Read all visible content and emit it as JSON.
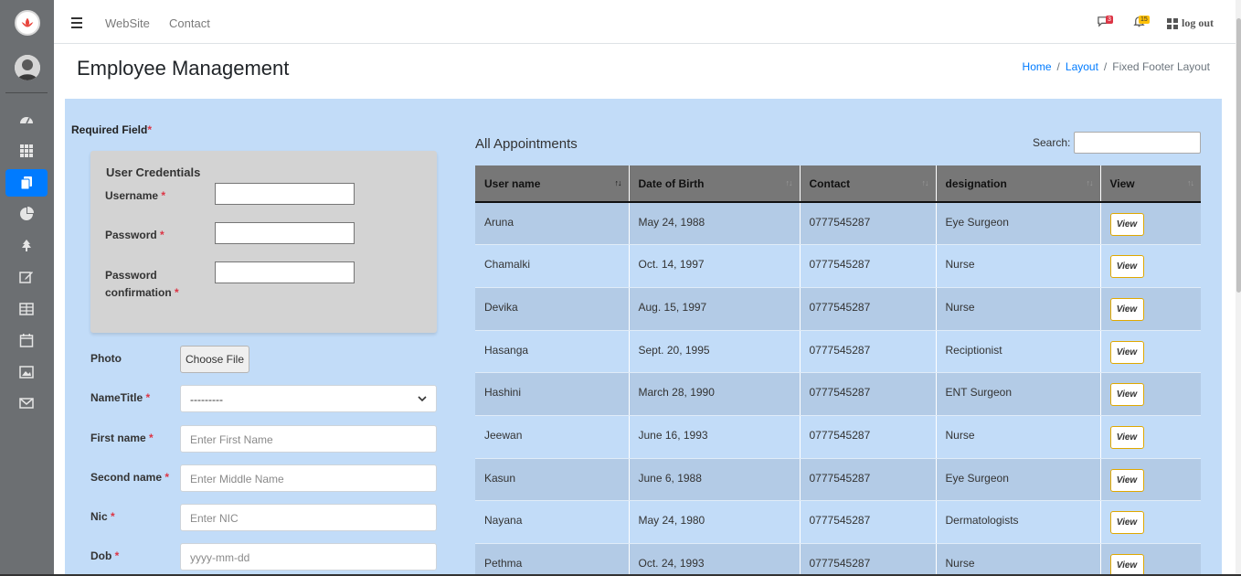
{
  "topbar": {
    "nav_links": [
      "WebSite",
      "Contact"
    ],
    "messages_badge": "3",
    "notifications_badge": "15",
    "logout_label": "log out"
  },
  "header": {
    "title": "Employee Management",
    "breadcrumb": [
      "Home",
      "Layout",
      "Fixed Footer Layout"
    ]
  },
  "sidebar": {
    "icons": [
      "dashboard-icon",
      "grid-icon",
      "copy-icon",
      "pie-chart-icon",
      "tree-icon",
      "edit-icon",
      "table-icon",
      "calendar-icon",
      "image-icon",
      "envelope-icon"
    ],
    "active_index": 2
  },
  "form": {
    "required_label": "Required Field",
    "credentials_title": "User Credentials",
    "username_label": "Username",
    "password_label": "Password",
    "password_confirmation_label_1": "Password",
    "password_confirmation_label_2": "confirmation",
    "photo_label": "Photo",
    "choose_file_label": "Choose File",
    "nametitle_label": "NameTitle",
    "nametitle_value": "---------",
    "first_name_label": "First name",
    "first_name_placeholder": "Enter First Name",
    "second_name_label": "Second name",
    "second_name_placeholder": "Enter Middle Name",
    "nic_label": "Nic",
    "nic_placeholder": "Enter NIC",
    "dob_label": "Dob",
    "dob_placeholder": "yyyy-mm-dd",
    "required_mark": "*"
  },
  "appointments": {
    "title": "All Appointments",
    "search_label": "Search:",
    "columns": [
      "User name",
      "Date of Birth",
      "Contact",
      "designation",
      "View"
    ],
    "view_label": "View",
    "rows": [
      [
        "Aruna",
        "May 24, 1988",
        "0777545287",
        "Eye Surgeon"
      ],
      [
        "Chamalki",
        "Oct. 14, 1997",
        "0777545287",
        "Nurse"
      ],
      [
        "Devika",
        "Aug. 15, 1997",
        "0777545287",
        "Nurse"
      ],
      [
        "Hasanga",
        "Sept. 20, 1995",
        "0777545287",
        "Reciptionist"
      ],
      [
        "Hashini",
        "March 28, 1990",
        "0777545287",
        "ENT Surgeon"
      ],
      [
        "Jeewan",
        "June 16, 1993",
        "0777545287",
        "Nurse"
      ],
      [
        "Kasun",
        "June 6, 1988",
        "0777545287",
        "Eye Surgeon"
      ],
      [
        "Nayana",
        "May 24, 1980",
        "0777545287",
        "Dermatologists"
      ],
      [
        "Pethma",
        "Oct. 24, 1993",
        "0777545287",
        "Nurse"
      ]
    ]
  },
  "colors": {
    "sidebar_bg": "#6c6f72",
    "active_blue": "#007bff",
    "content_bg": "#c2dcf8",
    "row_odd": "#b3cbe6",
    "table_header": "#777777",
    "view_border": "#e0a800",
    "required_red": "#dc3545"
  }
}
